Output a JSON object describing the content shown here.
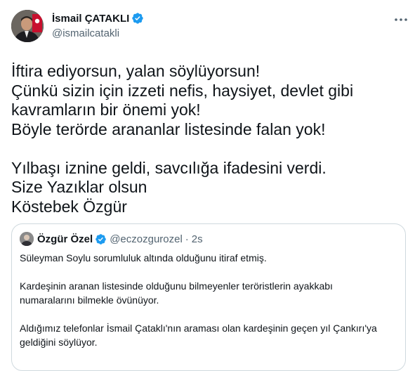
{
  "author": {
    "name": "İsmail ÇATAKLI",
    "handle": "@ismailcatakli"
  },
  "tweet_lines": [
    "İftira ediyorsun, yalan söylüyorsun!",
    "Çünkü sizin için izzeti nefis, haysiyet, devlet gibi",
    "kavramların bir önemi yok!",
    "Böyle terörde arananlar listesinde falan yok!",
    "",
    "Yılbaşı iznine geldi, savcılığa ifadesini verdi.",
    "Size Yazıklar olsun",
    "Köstebek Özgür"
  ],
  "quoted": {
    "name": "Özgür Özel",
    "handle": "@eczozgurozel",
    "separator": "·",
    "time": "2s",
    "lines": [
      "Süleyman Soylu sorumluluk altında olduğunu itiraf etmiş.",
      "",
      "Kardeşinin aranan listesinde olduğunu bilmeyenler teröristlerin ayakkabı",
      "numaralarını bilmekle övünüyor.",
      "",
      "Aldığımız telefonlar İsmail Çataklı'nın araması olan kardeşinin geçen yıl Çankırı'ya",
      "geldiğini söylüyor."
    ]
  },
  "icons": {
    "verified": "verified-badge-icon",
    "more": "more-options-icon"
  },
  "colors": {
    "text": "#0f1419",
    "secondary": "#536471",
    "verified": "#1d9bf0",
    "border": "#cfd9de"
  }
}
